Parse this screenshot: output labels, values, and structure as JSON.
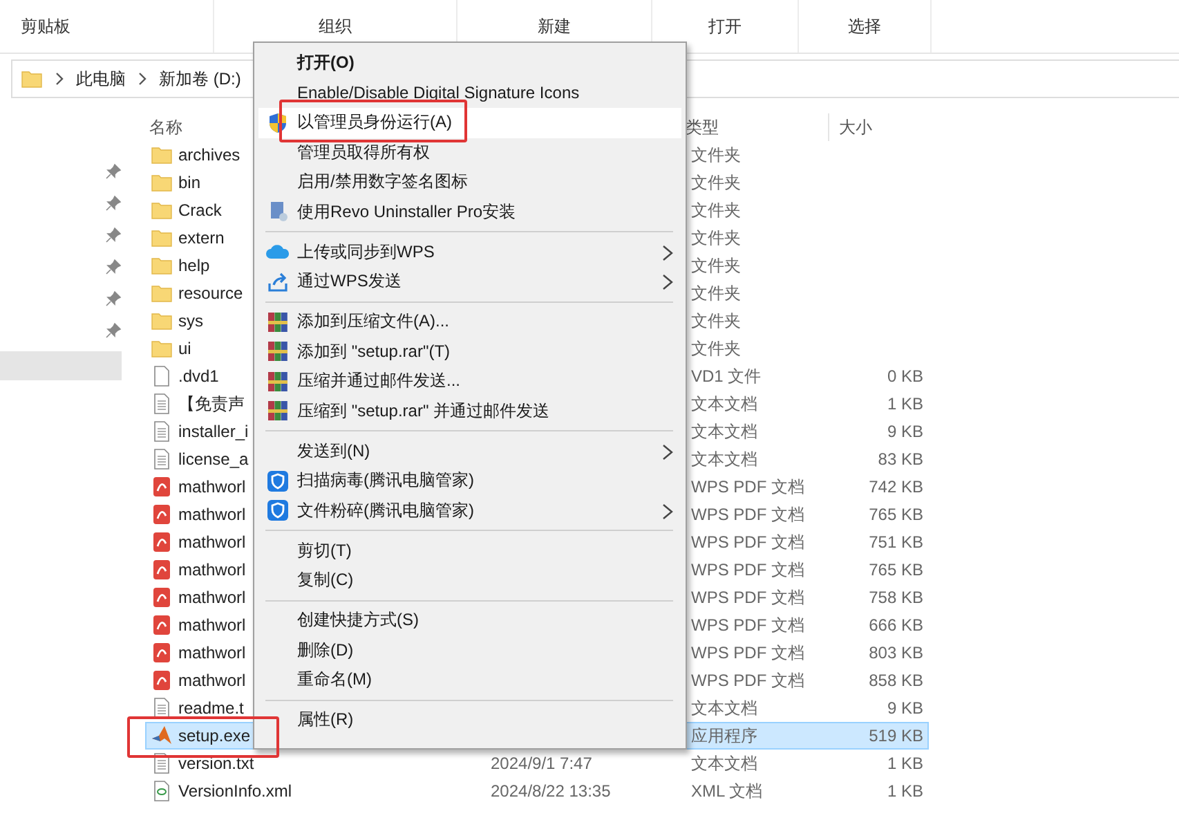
{
  "ribbon": {
    "groups": [
      "剪贴板",
      "组织",
      "新建",
      "打开",
      "选择"
    ]
  },
  "address_bar": {
    "path": [
      "此电脑",
      "新加卷 (D:)"
    ]
  },
  "file_list": {
    "columns": {
      "name": "名称",
      "type": "类型",
      "size": "大小"
    },
    "rows": [
      {
        "name": "archives",
        "kind": "folder",
        "type": "文件夹",
        "selected": false
      },
      {
        "name": "bin",
        "kind": "folder",
        "type": "文件夹",
        "selected": false
      },
      {
        "name": "Crack",
        "kind": "folder",
        "type": "文件夹",
        "selected": false
      },
      {
        "name": "extern",
        "kind": "folder",
        "type": "文件夹",
        "selected": false
      },
      {
        "name": "help",
        "kind": "folder",
        "type": "文件夹",
        "selected": false
      },
      {
        "name": "resource",
        "kind": "folder",
        "type": "文件夹",
        "selected": false
      },
      {
        "name": "sys",
        "kind": "folder",
        "type": "文件夹",
        "selected": false
      },
      {
        "name": "ui",
        "kind": "folder",
        "type": "文件夹",
        "selected": false
      },
      {
        "name": ".dvd1",
        "kind": "blank",
        "type": "VD1 文件",
        "size": "0 KB",
        "selected": false
      },
      {
        "name": "【免责声",
        "kind": "text",
        "type": "文本文档",
        "size": "1 KB",
        "selected": false
      },
      {
        "name": "installer_i",
        "kind": "text",
        "type": "文本文档",
        "size": "9 KB",
        "selected": false
      },
      {
        "name": "license_a",
        "kind": "text",
        "type": "文本文档",
        "size": "83 KB",
        "selected": false
      },
      {
        "name": "mathworl",
        "kind": "pdf",
        "type": "WPS PDF 文档",
        "size": "742 KB",
        "selected": false
      },
      {
        "name": "mathworl",
        "kind": "pdf",
        "type": "WPS PDF 文档",
        "size": "765 KB",
        "selected": false
      },
      {
        "name": "mathworl",
        "kind": "pdf",
        "type": "WPS PDF 文档",
        "size": "751 KB",
        "selected": false
      },
      {
        "name": "mathworl",
        "kind": "pdf",
        "type": "WPS PDF 文档",
        "size": "765 KB",
        "selected": false
      },
      {
        "name": "mathworl",
        "kind": "pdf",
        "type": "WPS PDF 文档",
        "size": "758 KB",
        "selected": false
      },
      {
        "name": "mathworl",
        "kind": "pdf",
        "type": "WPS PDF 文档",
        "size": "666 KB",
        "selected": false
      },
      {
        "name": "mathworl",
        "kind": "pdf",
        "type": "WPS PDF 文档",
        "size": "803 KB",
        "selected": false
      },
      {
        "name": "mathworl",
        "kind": "pdf",
        "type": "WPS PDF 文档",
        "size": "858 KB",
        "selected": false
      },
      {
        "name": "readme.t",
        "kind": "text",
        "type": "文本文档",
        "size": "9 KB",
        "selected": false
      },
      {
        "name": "setup.exe",
        "kind": "app",
        "type": "应用程序",
        "size": "519 KB",
        "selected": true
      },
      {
        "name": "version.txt",
        "kind": "text",
        "date": "2024/9/1 7:47",
        "type": "文本文档",
        "size": "1 KB",
        "selected": false
      },
      {
        "name": "VersionInfo.xml",
        "kind": "xml",
        "date": "2024/8/22 13:35",
        "type": "XML 文档",
        "size": "1 KB",
        "selected": false
      }
    ]
  },
  "context_menu": {
    "items": [
      {
        "kind": "plain",
        "label": "打开(O)",
        "default": true,
        "hovered": false,
        "submenu": false
      },
      {
        "kind": "plain",
        "label": "Enable/Disable Digital Signature Icons",
        "default": false,
        "hovered": false,
        "submenu": false
      },
      {
        "kind": "uac",
        "label": "以管理员身份运行(A)",
        "default": false,
        "hovered": true,
        "submenu": false
      },
      {
        "kind": "plain",
        "label": "管理员取得所有权",
        "default": false,
        "hovered": false,
        "submenu": false
      },
      {
        "kind": "plain",
        "label": "启用/禁用数字签名图标",
        "default": false,
        "hovered": false,
        "submenu": false
      },
      {
        "kind": "revo",
        "label": "使用Revo Uninstaller Pro安装",
        "default": false,
        "hovered": false,
        "submenu": false
      },
      {
        "kind": "separator"
      },
      {
        "kind": "cloud",
        "label": "上传或同步到WPS",
        "default": false,
        "hovered": false,
        "submenu": true
      },
      {
        "kind": "share",
        "label": "通过WPS发送",
        "default": false,
        "hovered": false,
        "submenu": true
      },
      {
        "kind": "separator"
      },
      {
        "kind": "archive",
        "label": "添加到压缩文件(A)...",
        "default": false,
        "hovered": false,
        "submenu": false
      },
      {
        "kind": "archive",
        "label": "添加到 \"setup.rar\"(T)",
        "default": false,
        "hovered": false,
        "submenu": false
      },
      {
        "kind": "archive",
        "label": "压缩并通过邮件发送...",
        "default": false,
        "hovered": false,
        "submenu": false
      },
      {
        "kind": "archive",
        "label": "压缩到 \"setup.rar\" 并通过邮件发送",
        "default": false,
        "hovered": false,
        "submenu": false
      },
      {
        "kind": "separator"
      },
      {
        "kind": "plain",
        "label": "发送到(N)",
        "default": false,
        "hovered": false,
        "submenu": true
      },
      {
        "kind": "guard",
        "label": "扫描病毒(腾讯电脑管家)",
        "default": false,
        "hovered": false,
        "submenu": false
      },
      {
        "kind": "guard",
        "label": "文件粉碎(腾讯电脑管家)",
        "default": false,
        "hovered": false,
        "submenu": true
      },
      {
        "kind": "separator"
      },
      {
        "kind": "plain",
        "label": "剪切(T)",
        "default": false,
        "hovered": false,
        "submenu": false
      },
      {
        "kind": "plain",
        "label": "复制(C)",
        "default": false,
        "hovered": false,
        "submenu": false
      },
      {
        "kind": "separator"
      },
      {
        "kind": "plain",
        "label": "创建快捷方式(S)",
        "default": false,
        "hovered": false,
        "submenu": false
      },
      {
        "kind": "plain",
        "label": "删除(D)",
        "default": false,
        "hovered": false,
        "submenu": false
      },
      {
        "kind": "plain",
        "label": "重命名(M)",
        "default": false,
        "hovered": false,
        "submenu": false
      },
      {
        "kind": "separator"
      },
      {
        "kind": "plain",
        "label": "属性(R)",
        "default": false,
        "hovered": false,
        "submenu": false
      }
    ]
  }
}
